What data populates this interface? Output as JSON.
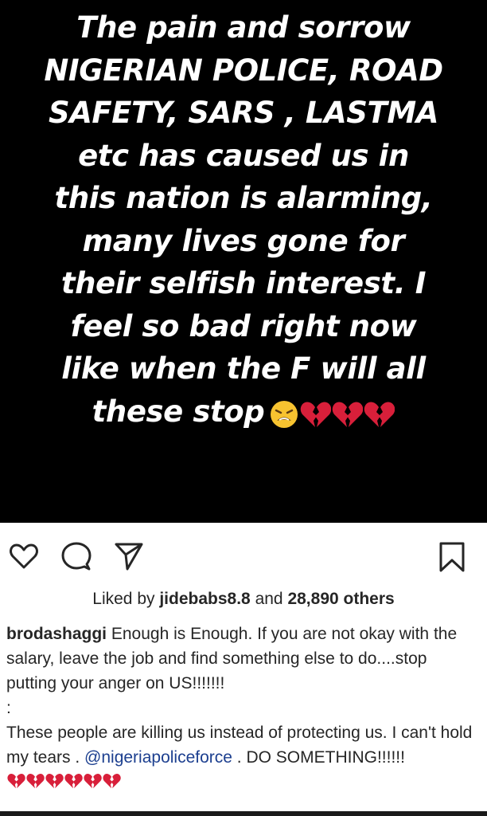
{
  "post": {
    "image_text": "The pain and sorrow\nNIGERIAN POLICE, ROAD\nSAFETY, SARS , LASTMA\netc has caused us in\nthis nation is alarming,\nmany lives gone for\ntheir selfish interest. I\nfeel so bad right now\nlike when the F will all\nthese stop",
    "emojis": [
      "weary-face-emoji",
      "broken-heart-emoji",
      "broken-heart-emoji",
      "broken-heart-emoji"
    ]
  },
  "actions": {
    "icons": [
      "heart-icon",
      "comment-icon",
      "share-icon",
      "bookmark-icon"
    ]
  },
  "likes": {
    "prefix": "Liked by ",
    "user": "jidebabs8.8",
    "middle": " and ",
    "others": "28,890 others"
  },
  "caption": {
    "username": "brodashaggi",
    "line1": " Enough is Enough. If you are not okay with the salary, leave the job and find something else to do....stop putting your anger on US!!!!!!!",
    "separator": ":",
    "line2a": "These people are killing us instead of protecting us. I can't hold my tears . ",
    "mention": "@nigeriapoliceforce",
    "line2b": " . DO SOMETHING!!!!!!",
    "trailing_emojis": [
      "broken-heart-emoji",
      "broken-heart-emoji",
      "broken-heart-emoji",
      "broken-heart-emoji",
      "broken-heart-emoji",
      "broken-heart-emoji"
    ]
  },
  "colors": {
    "image_bg": "#000000",
    "image_text": "#ffffff",
    "text": "#262626",
    "mention": "#1c3f8f",
    "heart_red": "#e0243a"
  }
}
